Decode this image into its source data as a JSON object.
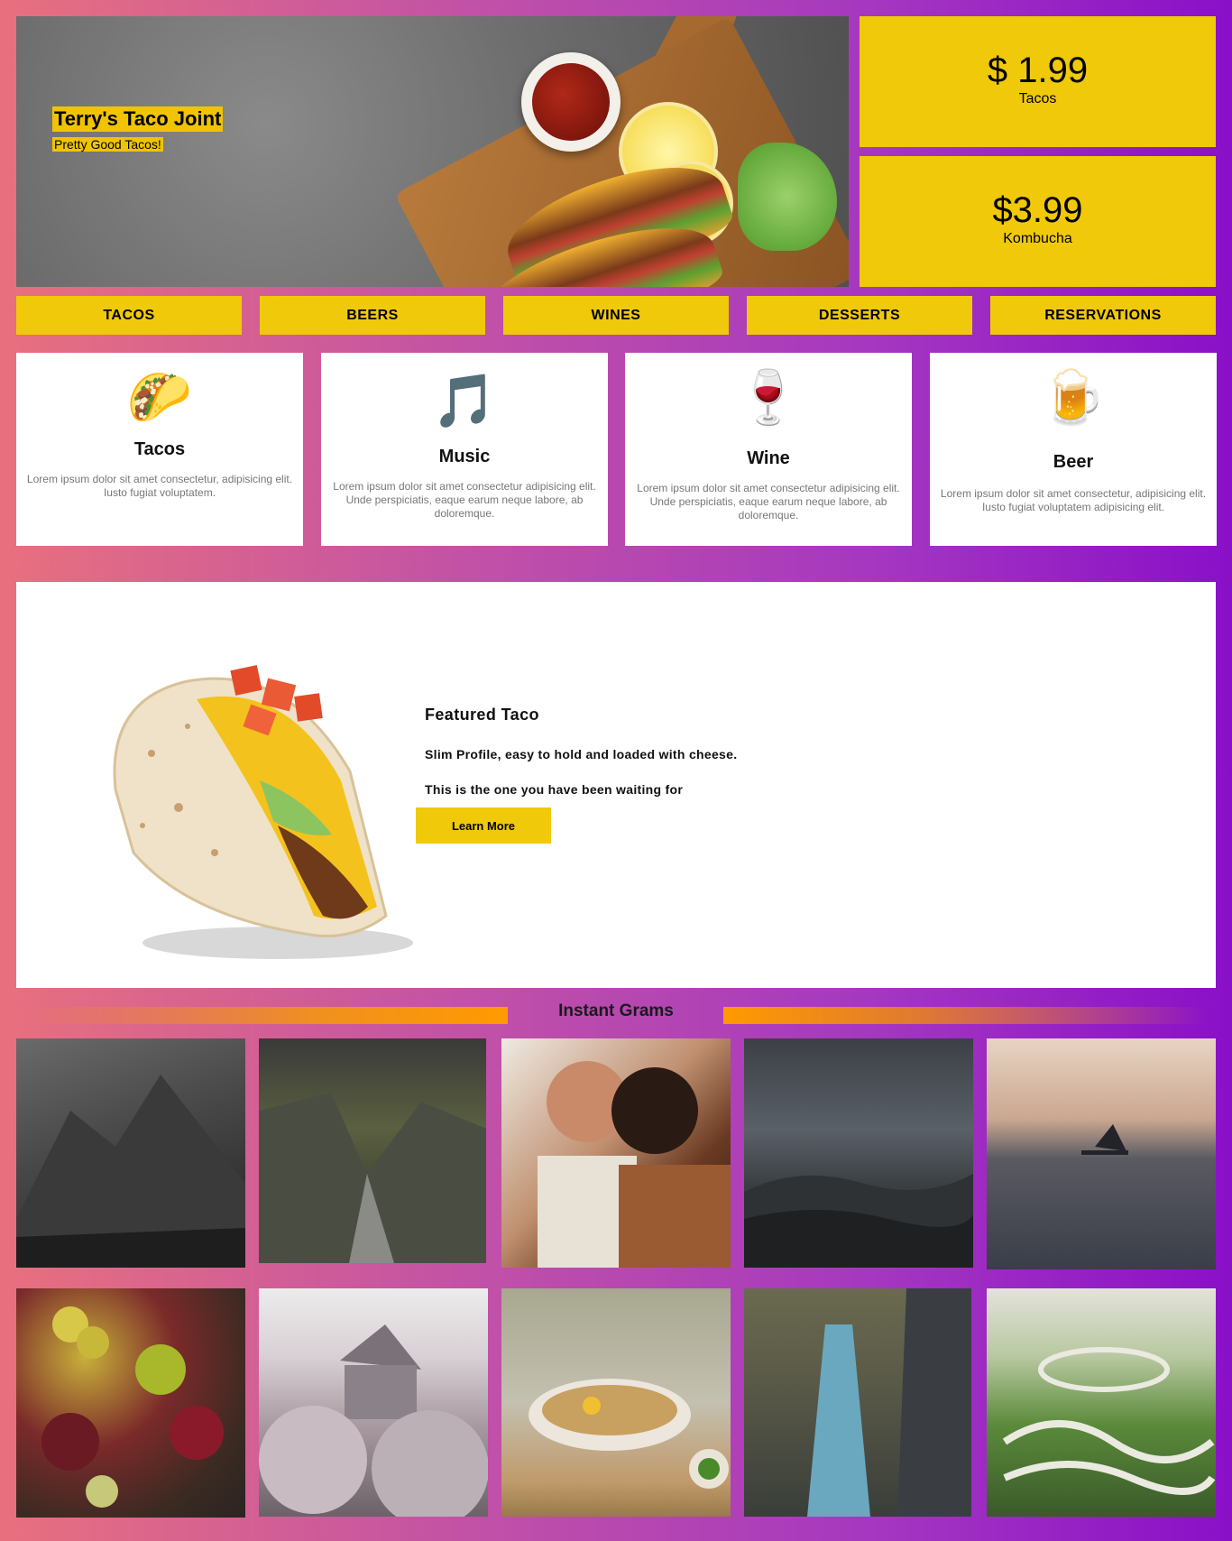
{
  "hero": {
    "title": "Terry's Taco Joint",
    "tagline": "Pretty Good Tacos!"
  },
  "prices": [
    {
      "amount": "$ 1.99",
      "label": "Tacos"
    },
    {
      "amount": "$3.99",
      "label": "Kombucha"
    }
  ],
  "nav": {
    "items": [
      {
        "label": "TACOS"
      },
      {
        "label": "BEERS"
      },
      {
        "label": "WINES"
      },
      {
        "label": "DESSERTS"
      },
      {
        "label": "RESERVATIONS"
      }
    ]
  },
  "cards": [
    {
      "icon": "🌮",
      "icon_name": "taco-icon",
      "title": "Tacos",
      "desc": "Lorem ipsum dolor sit amet consectetur, adipisicing elit. Iusto fugiat voluptatem."
    },
    {
      "icon": "🎵",
      "icon_name": "music-note-icon",
      "title": "Music",
      "desc": "Lorem ipsum dolor sit amet consectetur adipisicing elit. Unde perspiciatis, eaque earum neque labore, ab doloremque."
    },
    {
      "icon": "🍷",
      "icon_name": "wine-glass-icon",
      "title": "Wine",
      "desc": "Lorem ipsum dolor sit amet consectetur adipisicing elit. Unde perspiciatis, eaque earum neque labore, ab doloremque."
    },
    {
      "icon": "🍺",
      "icon_name": "beer-mug-icon",
      "title": "Beer",
      "desc": "Lorem ipsum dolor sit amet consectetur, adipisicing elit. Iusto fugiat voluptatem adipisicing elit."
    }
  ],
  "featured": {
    "title": "Featured Taco",
    "line1": "Slim Profile, easy to hold and loaded with cheese.",
    "line2": "This is the one you have been waiting for",
    "button": "Learn More"
  },
  "grams": {
    "title": "Instant Grams",
    "photos": [
      {
        "name": "gram-photo-mountain-peak"
      },
      {
        "name": "gram-photo-cliff-valley"
      },
      {
        "name": "gram-photo-couple"
      },
      {
        "name": "gram-photo-stormy-hills"
      },
      {
        "name": "gram-photo-sailboat-sunset"
      },
      {
        "name": "gram-photo-fruit"
      },
      {
        "name": "gram-photo-blossom-house"
      },
      {
        "name": "gram-photo-noodle-bowl"
      },
      {
        "name": "gram-photo-waterfall"
      },
      {
        "name": "gram-photo-garden-maze"
      }
    ]
  },
  "colors": {
    "accent_yellow": "#f0c90a",
    "gradient_left": "#e8707e",
    "gradient_right": "#8a10c8",
    "orange_bar": "#ff9a00"
  }
}
